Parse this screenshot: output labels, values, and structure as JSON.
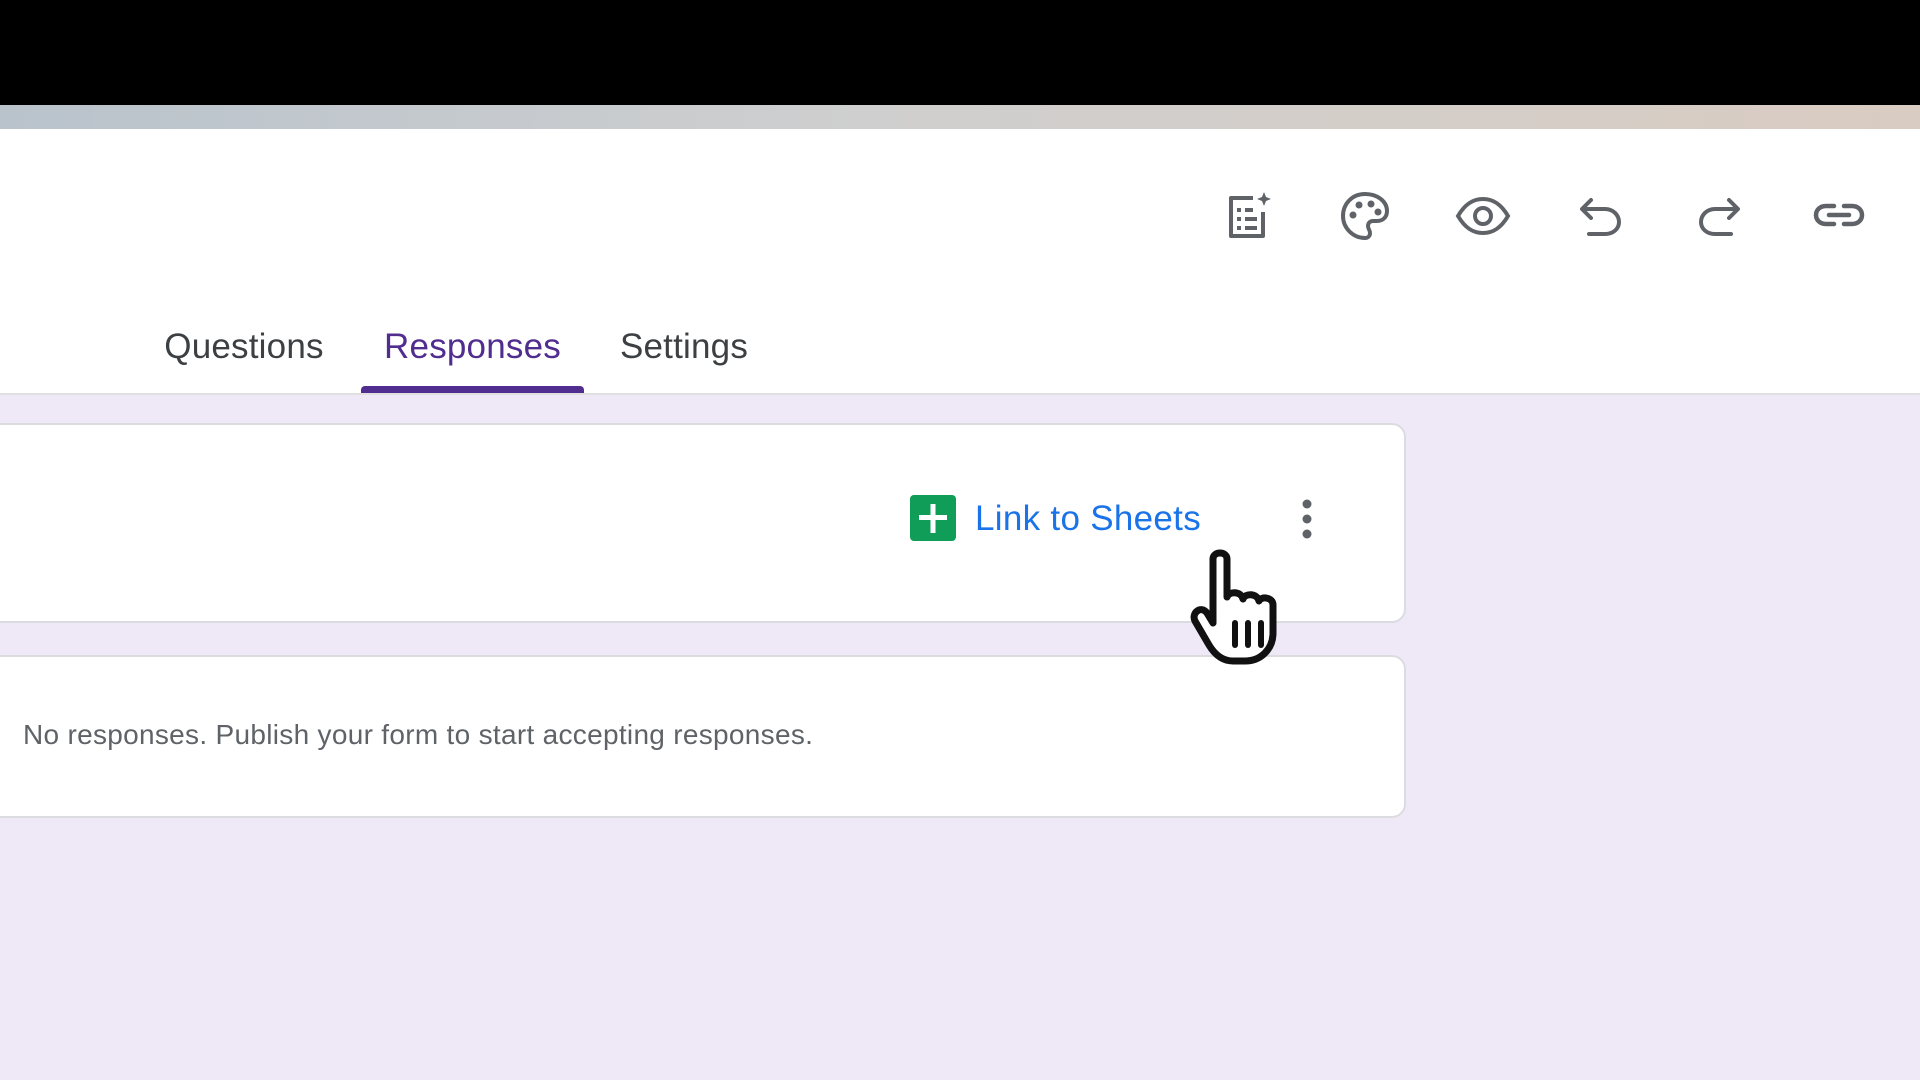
{
  "toolbar": {
    "icons": [
      "ai-form-icon",
      "palette-icon",
      "eye-icon",
      "undo-icon",
      "redo-icon",
      "link-icon"
    ]
  },
  "tabs": [
    {
      "label": "Questions",
      "active": false
    },
    {
      "label": "Responses",
      "active": true
    },
    {
      "label": "Settings",
      "active": false
    }
  ],
  "responses": {
    "link_to_sheets_label": "Link to Sheets",
    "empty_message": "No responses. Publish your form to start accepting responses."
  },
  "colors": {
    "accent": "#512d8f",
    "link": "#1a73e8",
    "sheets_green": "#0f9d58",
    "background": "#efe9f7"
  }
}
